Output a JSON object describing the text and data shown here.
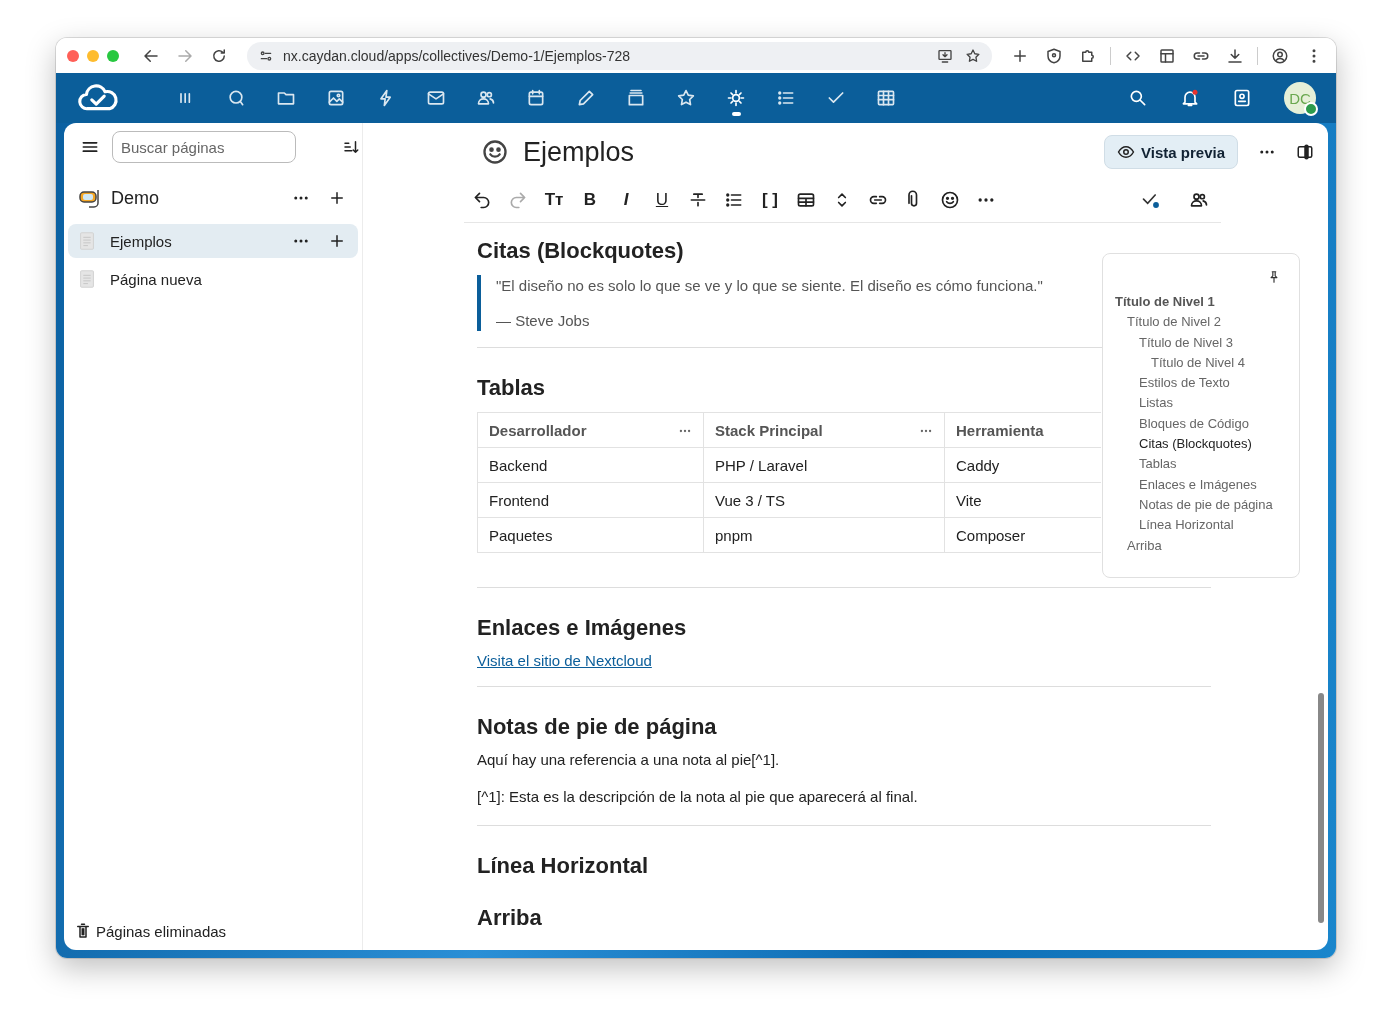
{
  "browser": {
    "url": "nx.caydan.cloud/apps/collectives/Demo-1/Ejemplos-728"
  },
  "header": {
    "apps": [
      {
        "selected": false
      },
      {
        "selected": false
      },
      {
        "selected": false
      },
      {
        "selected": false
      },
      {
        "selected": false
      },
      {
        "selected": false
      },
      {
        "selected": false
      },
      {
        "selected": false
      },
      {
        "selected": false
      },
      {
        "selected": false
      },
      {
        "selected": false
      },
      {
        "selected": true
      },
      {
        "selected": false
      },
      {
        "selected": false
      },
      {
        "selected": false
      }
    ],
    "avatar": "DC"
  },
  "sidebar": {
    "search": {
      "placeholder": "Buscar páginas"
    },
    "collective": "Demo",
    "pages": [
      {
        "title": "Ejemplos",
        "selected": true
      },
      {
        "title": "Página nueva",
        "selected": false
      }
    ],
    "footer": "Páginas eliminadas"
  },
  "page": {
    "title": "Ejemplos",
    "preview_button": "Vista previa"
  },
  "toolbar": [
    {
      "kind": "icon",
      "disabled": false
    },
    {
      "kind": "icon",
      "disabled": true
    },
    {
      "kind": "glyph",
      "text": "Tт",
      "disabled": false
    },
    {
      "kind": "glyph",
      "text": "B",
      "disabled": false
    },
    {
      "kind": "glyph",
      "text": "I",
      "disabled": false
    },
    {
      "kind": "glyph",
      "text": "U",
      "disabled": false
    },
    {
      "kind": "icon",
      "disabled": false
    },
    {
      "kind": "icon",
      "disabled": false
    },
    {
      "kind": "glyph",
      "text": "[ ]",
      "disabled": false
    },
    {
      "kind": "icon",
      "disabled": false
    },
    {
      "kind": "icon",
      "disabled": false
    },
    {
      "kind": "icon",
      "disabled": false
    },
    {
      "kind": "icon",
      "disabled": false
    },
    {
      "kind": "icon",
      "disabled": false
    },
    {
      "kind": "icon",
      "disabled": false
    }
  ],
  "content": [
    {
      "kind": "heading",
      "text": "Citas (Blockquotes)"
    },
    {
      "kind": "quote",
      "text": "\"El diseño no es solo lo que se ve y lo que se siente. El diseño es cómo funciona.\"",
      "attribution": "— Steve Jobs"
    },
    {
      "kind": "rule"
    },
    {
      "kind": "heading",
      "text": "Tablas"
    },
    {
      "kind": "table",
      "columns": [
        "Desarrollador",
        "Stack Principal",
        "Herramienta"
      ],
      "rows": [
        [
          "Backend",
          "PHP / Laravel",
          "Caddy"
        ],
        [
          "Frontend",
          "Vue 3 / TS",
          "Vite"
        ],
        [
          "Paquetes",
          "pnpm",
          "Composer"
        ]
      ]
    },
    {
      "kind": "rule"
    },
    {
      "kind": "heading",
      "text": "Enlaces e Imágenes"
    },
    {
      "kind": "link",
      "text": "Visita el sitio de Nextcloud"
    },
    {
      "kind": "rule"
    },
    {
      "kind": "heading",
      "text": "Notas de pie de página"
    },
    {
      "kind": "paragraph",
      "text": "Aquí hay una referencia a una nota al pie[^1]."
    },
    {
      "kind": "paragraph",
      "text": "[^1]: Esta es la descripción de la nota al pie que aparecerá al final."
    },
    {
      "kind": "rule"
    },
    {
      "kind": "heading",
      "text": "Línea Horizontal"
    },
    {
      "kind": "heading",
      "text": "Arriba"
    }
  ],
  "toc": {
    "items": [
      {
        "text": "Título de Nivel 1",
        "active": false,
        "children": [
          {
            "text": "Título de Nivel 2",
            "active": false,
            "children": [
              {
                "text": "Título de Nivel 3",
                "active": false,
                "children": [
                  {
                    "text": "Título de Nivel 4",
                    "active": false
                  }
                ]
              },
              {
                "text": "Estilos de Texto",
                "active": false
              },
              {
                "text": "Listas",
                "active": false
              },
              {
                "text": "Bloques de Código",
                "active": false
              },
              {
                "text": "Citas (Blockquotes)",
                "active": true
              },
              {
                "text": "Tablas",
                "active": false
              },
              {
                "text": "Enlaces e Imágenes",
                "active": false
              },
              {
                "text": "Notas de pie de página",
                "active": false
              },
              {
                "text": "Línea Horizontal",
                "active": false
              }
            ]
          },
          {
            "text": "Arriba",
            "active": false
          }
        ]
      }
    ]
  }
}
